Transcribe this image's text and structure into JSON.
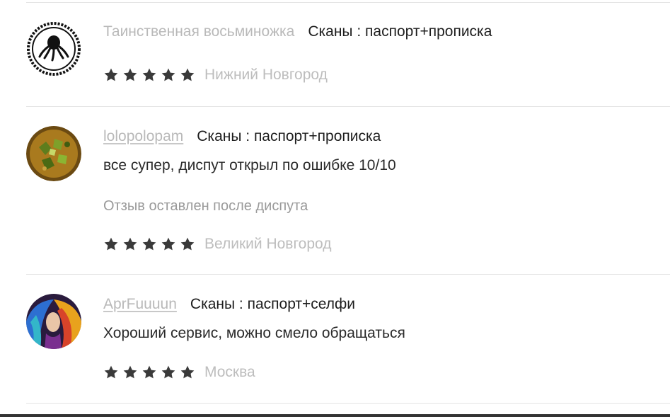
{
  "reviews": [
    {
      "author": "Таинственная восьминожка",
      "product": "Сканы : паспорт+прописка",
      "rating": 5,
      "city": "Нижний Новгород",
      "avatar_icon": "octopus-icon"
    },
    {
      "author": "lolopolopam",
      "product": "Сканы : паспорт+прописка",
      "text": "все супер, диспут открыл по ошибке 10/10",
      "note": "Отзыв оставлен после диспута",
      "rating": 5,
      "city": "Великий Новгород",
      "avatar_icon": "food-photo-avatar"
    },
    {
      "author": "AprFuuuun",
      "product": "Сканы : паспорт+селфи",
      "text": "Хороший сервис, можно смело обращаться",
      "rating": 5,
      "city": "Москва",
      "avatar_icon": "colorful-art-avatar"
    }
  ],
  "colors": {
    "star": "#3a3a3a",
    "muted": "#b9b9b9",
    "divider": "#e4e4e4"
  }
}
